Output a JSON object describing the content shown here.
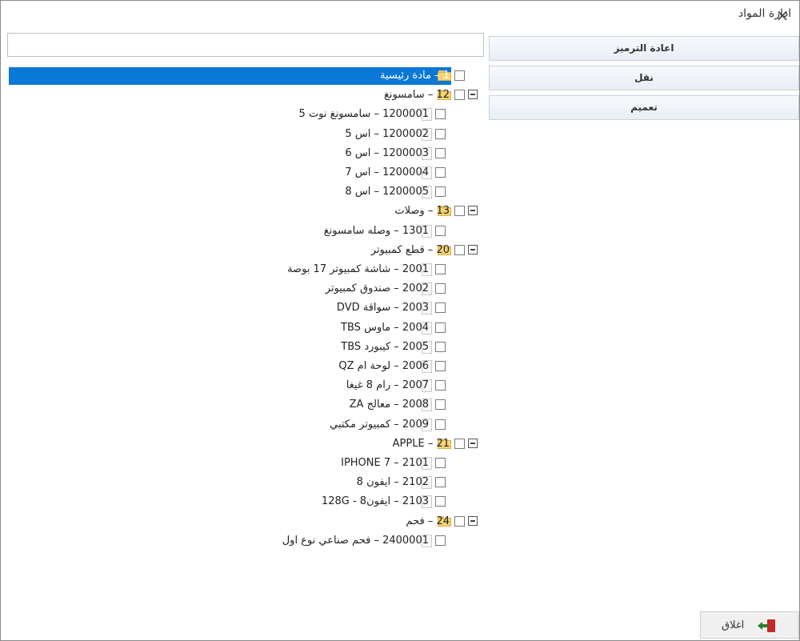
{
  "window": {
    "title": "ادارة المواد",
    "close_glyph": "×"
  },
  "search": {
    "value": "",
    "placeholder": ""
  },
  "actions": {
    "renumber": "اعادة الترميز",
    "move": "نقل",
    "generalize": "تعميم"
  },
  "tree": {
    "items": [
      {
        "label": "1 – مادة رئيسية",
        "type": "folder",
        "selected": true
      },
      {
        "label": "12 – سامسونغ",
        "type": "folder",
        "expanded": true
      },
      {
        "label": "1200001 – سامسونغ نوت 5",
        "type": "item"
      },
      {
        "label": "1200002 – اس 5",
        "type": "item"
      },
      {
        "label": "1200003 – اس 6",
        "type": "item"
      },
      {
        "label": "1200004 – اس 7",
        "type": "item"
      },
      {
        "label": "1200005 – اس 8",
        "type": "item"
      },
      {
        "label": "13 – وصلات",
        "type": "folder",
        "expanded": true
      },
      {
        "label": "1301 – وصله سامسونغ",
        "type": "item"
      },
      {
        "label": "20 – قطع كمبيوتر",
        "type": "folder",
        "expanded": true
      },
      {
        "label": "2001 – شاشة كمبيوتر 17 بوصة",
        "type": "item"
      },
      {
        "label": "2002 – صندوق كمبيوتر",
        "type": "item"
      },
      {
        "label": "2003 – سواقة DVD",
        "type": "item"
      },
      {
        "label": "2004 – ماوس TBS",
        "type": "item"
      },
      {
        "label": "2005 – كيبورد TBS",
        "type": "item"
      },
      {
        "label": "2006 – لوحة ام QZ",
        "type": "item"
      },
      {
        "label": "2007 – رام 8 غيغا",
        "type": "item"
      },
      {
        "label": "2008 – معالج ZA",
        "type": "item"
      },
      {
        "label": "2009 – كمبيوتر مكتبي",
        "type": "item"
      },
      {
        "label": "21 – APPLE",
        "type": "folder",
        "expanded": true
      },
      {
        "label": "2101 – IPHONE 7",
        "type": "item"
      },
      {
        "label": "2102 – ايفون 8",
        "type": "item"
      },
      {
        "label": "2103 – ايفون8 - 128G",
        "type": "item"
      },
      {
        "label": "24 – فحم",
        "type": "folder",
        "expanded": true
      },
      {
        "label": "2400001 – فحم صناعي نوع اول",
        "type": "item"
      }
    ]
  },
  "footer": {
    "close_label": "اغلاق"
  },
  "icons": {
    "window_close": "close-icon",
    "folder": "folder-icon",
    "item": "document-icon",
    "expander": "collapse-icon",
    "checkbox": "checkbox-icon",
    "exit": "exit-icon"
  },
  "colors": {
    "selection": "#0a78d7",
    "button_bg": "#eef2f7"
  }
}
